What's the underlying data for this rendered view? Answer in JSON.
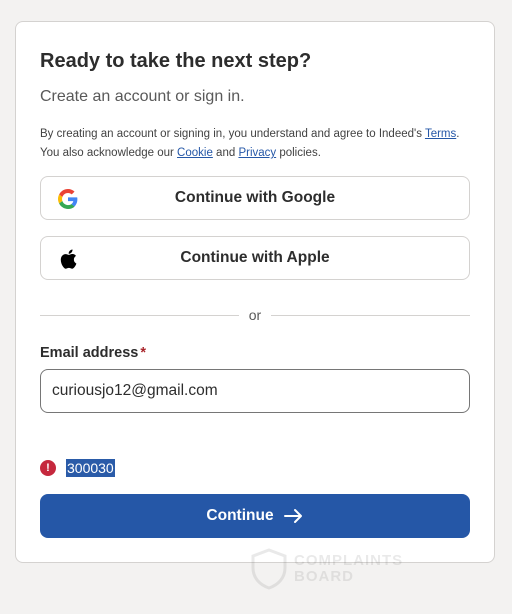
{
  "card": {
    "title": "Ready to take the next step?",
    "subtitle": "Create an account or sign in.",
    "legal": {
      "prefix": "By creating an account or signing in, you understand and agree to Indeed's ",
      "terms": "Terms",
      "middle": ". You also acknowledge our ",
      "cookie": "Cookie",
      "and": " and ",
      "privacy": "Privacy",
      "suffix": " policies."
    },
    "google_button": "Continue with Google",
    "apple_button": "Continue with Apple",
    "divider_text": "or",
    "email_label": "Email address",
    "email_required_mark": "*",
    "email_value": "curiousjo12@gmail.com",
    "error_code": "300030",
    "continue_button": "Continue"
  },
  "watermark": {
    "line1": "COMPLAINTS",
    "line2": "BOARD"
  },
  "colors": {
    "primary": "#2557a7",
    "error": "#c5283d",
    "required": "#a9252b"
  }
}
